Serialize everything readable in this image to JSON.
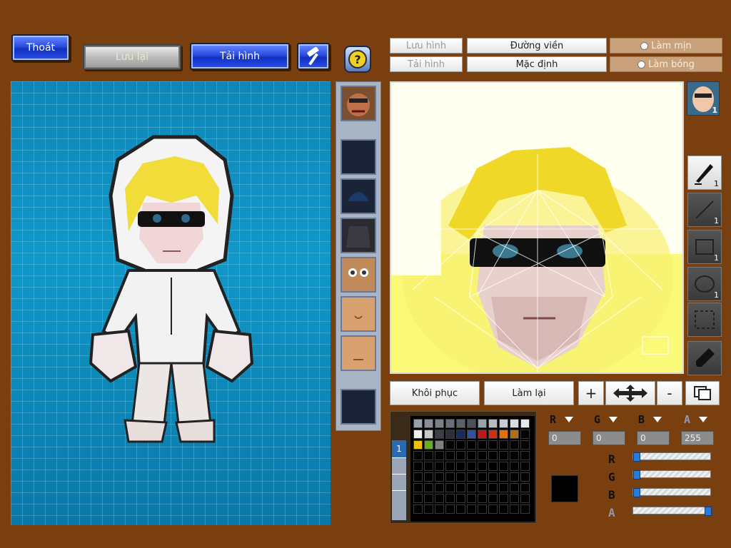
{
  "top": {
    "exit_label": "Thoát",
    "save_label": "Lưu lại",
    "load_image_label": "Tải hình",
    "help_symbol": "?"
  },
  "editor": {
    "save_image_label": "Lưu hình",
    "load_image_label": "Tải hình",
    "outline_label": "Đường viền",
    "default_label": "Mặc định",
    "smooth_label": "Làm mịn",
    "shine_label": "Làm bóng",
    "restore_label": "Khôi phục",
    "redo_label": "Làm lại",
    "zoom_in_symbol": "+",
    "zoom_out_symbol": "-",
    "layer_badge": "1"
  },
  "tools": [
    {
      "name": "pen-tool",
      "icon": "pen-icon",
      "count": "1"
    },
    {
      "name": "line-tool",
      "icon": "line-icon",
      "count": "1"
    },
    {
      "name": "rectangle-tool",
      "icon": "rectangle-icon",
      "count": "1"
    },
    {
      "name": "ellipse-tool",
      "icon": "ellipse-icon",
      "count": "1"
    },
    {
      "name": "selection-tool",
      "icon": "selection-icon",
      "count": ""
    },
    {
      "name": "eyedropper-tool",
      "icon": "eyedropper-icon",
      "count": ""
    }
  ],
  "color": {
    "r_label": "R",
    "g_label": "G",
    "b_label": "B",
    "a_label": "A",
    "r_value": "0",
    "g_value": "0",
    "b_value": "0",
    "a_value": "255",
    "r": 0,
    "g": 0,
    "b": 0,
    "a": 255,
    "current_color": "#000000",
    "palette_row1": [
      "#9aa0a8",
      "#8a8f97",
      "#7a7f87",
      "#6b7078",
      "#5c6168",
      "#4d5259",
      "#9aa0a8",
      "#b8bcc2",
      "#c8ccd2",
      "#d8dce2",
      "#e6e8ec"
    ],
    "palette_row2": [
      "#f0f0f0",
      "#c8c8c8",
      "#3a3f48",
      "#2a2f38",
      "#1a2a5a",
      "#3050a0",
      "#c01818",
      "#d03010",
      "#e07010",
      "#b07010"
    ],
    "palette_row3": [
      "#f0c010",
      "#60b020",
      "#808080"
    ],
    "palette_tab": "1"
  },
  "parts_thumbs": [
    "face-thumb",
    "empty-slot",
    "helmet-thumb",
    "hair-thumb",
    "eyes-thumb",
    "nose-thumb",
    "mouth-thumb",
    "empty-slot"
  ]
}
